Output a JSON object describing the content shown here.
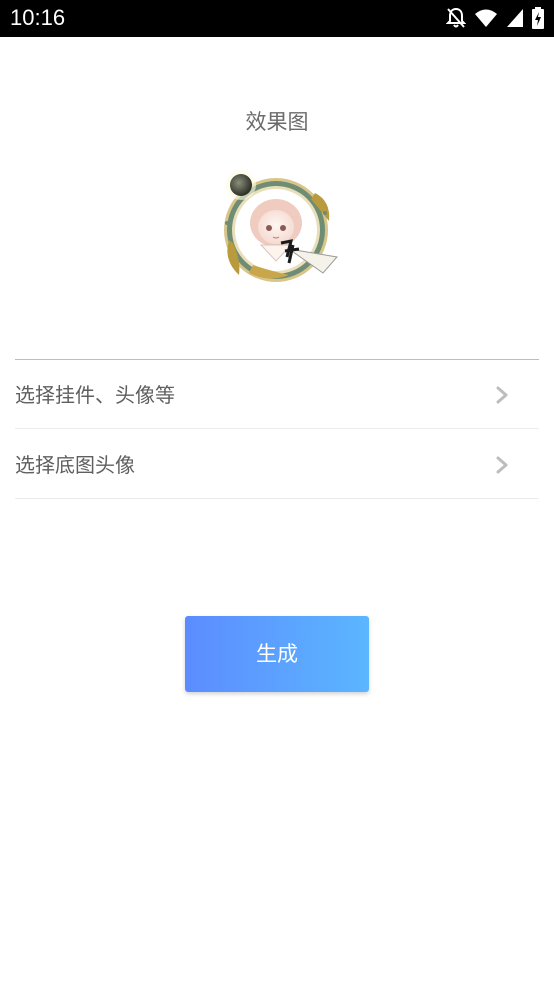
{
  "status_bar": {
    "time": "10:16",
    "icons": [
      "notifications-off-icon",
      "wifi-icon",
      "cellular-signal-icon",
      "battery-charging-icon"
    ]
  },
  "preview": {
    "title": "效果图",
    "avatar_icon": "avatar-with-frame-image"
  },
  "options": [
    {
      "label": "选择挂件、头像等",
      "icon": "chevron-right-icon"
    },
    {
      "label": "选择底图头像",
      "icon": "chevron-right-icon"
    }
  ],
  "generate_button": {
    "label": "生成"
  },
  "colors": {
    "button_gradient_start": "#5c8cff",
    "button_gradient_end": "#5bb6ff",
    "label_text": "#5f5f5f",
    "chevron": "#bdbdbd"
  }
}
